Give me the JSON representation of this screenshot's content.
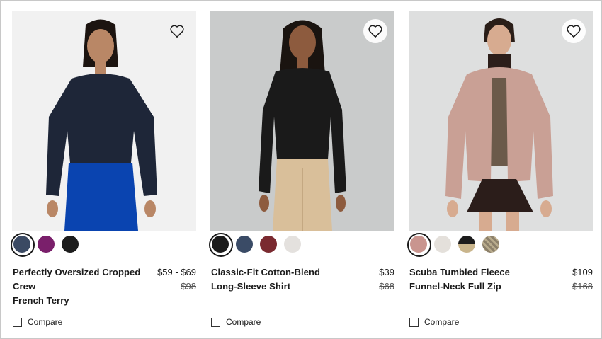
{
  "products": [
    {
      "title": "Perfectly Oversized Cropped Crew",
      "subtitle": "French Terry",
      "price": "$59 - $69",
      "was_price": "$98",
      "compare_label": "Compare",
      "swatches": [
        "#3b4a63",
        "#7a1f6b",
        "#1d1d1d"
      ],
      "selected_swatch": 0
    },
    {
      "title": "Classic-Fit Cotton-Blend Long-Sleeve Shirt",
      "subtitle": "",
      "price": "$39",
      "was_price": "$68",
      "compare_label": "Compare",
      "swatches": [
        "#1b1b1b",
        "#3a4b66",
        "#7a2a30",
        "#e4e1de"
      ],
      "selected_swatch": 0
    },
    {
      "title": "Scuba Tumbled Fleece Funnel-Neck Full Zip",
      "subtitle": "",
      "price": "$109",
      "was_price": "$168",
      "compare_label": "Compare",
      "swatches": [
        "#c9958f",
        "#e4e0db",
        "#c9b58c",
        "#8c806a"
      ],
      "selected_swatch": 0
    }
  ]
}
